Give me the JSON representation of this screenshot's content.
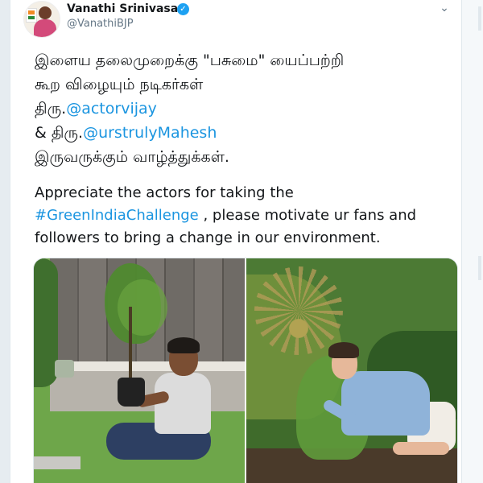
{
  "tweet": {
    "author": {
      "display_name": "Vanathi Srinivasan",
      "handle": "@VanathiBJP",
      "verified": true
    },
    "text_tamil": {
      "line1": "இளைய தலைமுறைக்கு \"பசுமை\" யைப்பற்றி",
      "line2": "கூற விழையும் நடிகர்கள்",
      "line3_prefix": "திரு.",
      "line3_mention": "@actorvijay",
      "line4_prefix": "& திரு.",
      "line4_mention": "@urstrulyMahesh",
      "line5": "இருவருக்கும் வாழ்த்துக்கள்."
    },
    "text_english": {
      "line1": " Appreciate the actors for taking the",
      "line2_hashtag": "#GreenIndiaChallenge",
      "line2_rest": " , please motivate ur fans and",
      "line3": "followers to bring a change in our environment."
    },
    "media": {
      "count": 2
    }
  },
  "colors": {
    "link": "#1b95e0",
    "verified": "#1da1f2",
    "text": "#14171a",
    "secondary": "#657786"
  },
  "icons": {
    "verified": "verified-check-icon",
    "menu": "chevron-down-icon"
  }
}
